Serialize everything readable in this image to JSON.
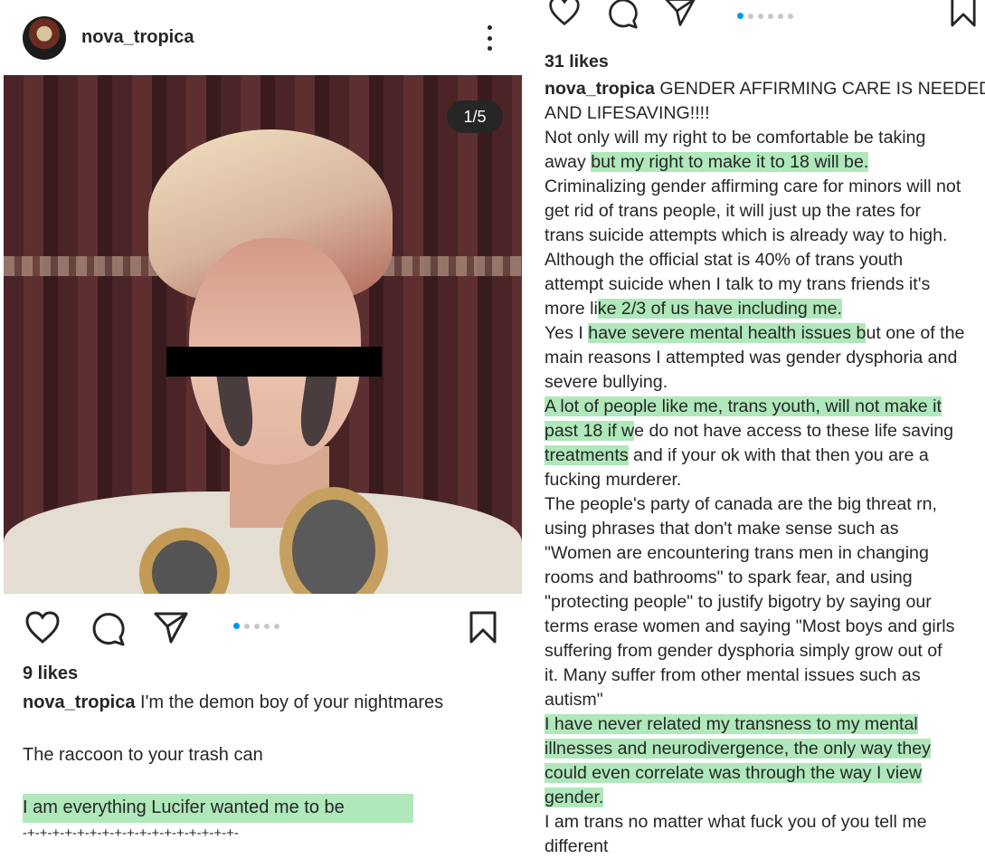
{
  "left_post": {
    "username": "nova_tropica",
    "image_counter": "1/5",
    "likes": "9 likes",
    "caption": {
      "username": "nova_tropica",
      "text": "I'm the demon boy of your nightmares",
      "line2": "The raccoon to your trash can",
      "line3": "I am everything Lucifer wanted me to be",
      "line4": "-+-+-+-+-+-+-+-+-+-+-+-+-+-+-+-+-+-"
    },
    "carousel": {
      "count": 5,
      "active": 0
    }
  },
  "right_post": {
    "likes": "31 likes",
    "carousel": {
      "count": 6,
      "active": 0
    },
    "caption_user": "nova_tropica",
    "lines": [
      {
        "segments": [
          {
            "t": " GENDER AFFIRMING CARE IS NEEDED",
            "h": false
          }
        ]
      },
      {
        "segments": [
          {
            "t": "AND LIFESAVING!!!!",
            "h": false
          }
        ]
      },
      {
        "segments": [
          {
            "t": "Not only will my right to be comfortable be taking",
            "h": false
          }
        ]
      },
      {
        "segments": [
          {
            "t": "away ",
            "h": false
          },
          {
            "t": "but my right to make it to 18 will be.",
            "h": true
          }
        ]
      },
      {
        "segments": [
          {
            "t": "Criminalizing gender affirming care for minors will not",
            "h": false
          }
        ]
      },
      {
        "segments": [
          {
            "t": "get rid of trans people, it will just up the rates for",
            "h": false
          }
        ]
      },
      {
        "segments": [
          {
            "t": "trans suicide attempts which is already way to high.",
            "h": false
          }
        ]
      },
      {
        "segments": [
          {
            "t": "Although the official stat is 40% of trans youth",
            "h": false
          }
        ]
      },
      {
        "segments": [
          {
            "t": "attempt suicide when I talk to my trans friends it's",
            "h": false
          }
        ]
      },
      {
        "segments": [
          {
            "t": "more li",
            "h": false
          },
          {
            "t": "ke 2/3 of us have including me.",
            "h": true
          }
        ]
      },
      {
        "segments": [
          {
            "t": "Yes I ",
            "h": false
          },
          {
            "t": "have severe mental health issues b",
            "h": true
          },
          {
            "t": "ut one of the",
            "h": false
          }
        ]
      },
      {
        "segments": [
          {
            "t": "main reasons I attempted was gender dysphoria and",
            "h": false
          }
        ]
      },
      {
        "segments": [
          {
            "t": "severe bullying.",
            "h": false
          }
        ]
      },
      {
        "segments": [
          {
            "t": "A lot of people like me, trans youth, will not make it",
            "h": true
          }
        ]
      },
      {
        "segments": [
          {
            "t": "past 18 if w",
            "h": true
          },
          {
            "t": "e do not have access to these life saving",
            "h": false
          }
        ]
      },
      {
        "segments": [
          {
            "t": "treatments",
            "h": true
          },
          {
            "t": " and if your ok with that then you are a",
            "h": false
          }
        ]
      },
      {
        "segments": [
          {
            "t": "fucking murderer.",
            "h": false
          }
        ]
      },
      {
        "segments": [
          {
            "t": "The people's party of canada are the big threat rn,",
            "h": false
          }
        ]
      },
      {
        "segments": [
          {
            "t": "using phrases that don't make sense such as",
            "h": false
          }
        ]
      },
      {
        "segments": [
          {
            "t": "\"Women are encountering trans men in changing",
            "h": false
          }
        ]
      },
      {
        "segments": [
          {
            "t": "rooms and bathrooms\" to spark fear, and using",
            "h": false
          }
        ]
      },
      {
        "segments": [
          {
            "t": "\"protecting people\" to justify bigotry by saying our",
            "h": false
          }
        ]
      },
      {
        "segments": [
          {
            "t": "terms erase women and saying \"Most boys and girls",
            "h": false
          }
        ]
      },
      {
        "segments": [
          {
            "t": "suffering from gender dysphoria simply grow out of",
            "h": false
          }
        ]
      },
      {
        "segments": [
          {
            "t": "it. Many suffer from other mental issues such as",
            "h": false
          }
        ]
      },
      {
        "segments": [
          {
            "t": "autism\"",
            "h": false
          }
        ]
      },
      {
        "segments": [
          {
            "t": "I have never related my transness to my mental",
            "h": true
          }
        ]
      },
      {
        "segments": [
          {
            "t": "illnesses and neurodivergence, the only way they",
            "h": true
          }
        ]
      },
      {
        "segments": [
          {
            "t": "could even correlate was through the way I view",
            "h": true
          }
        ]
      },
      {
        "segments": [
          {
            "t": "gender.",
            "h": true
          }
        ]
      },
      {
        "segments": [
          {
            "t": "I am trans no matter what fuck you of you tell me",
            "h": false
          }
        ]
      },
      {
        "segments": [
          {
            "t": "different",
            "h": false
          }
        ]
      }
    ]
  },
  "colors": {
    "highlight": "#6ed682",
    "accent": "#0095f6",
    "text": "#262626"
  },
  "icons": [
    "heart-icon",
    "comment-icon",
    "share-icon",
    "bookmark-icon",
    "more-icon"
  ]
}
